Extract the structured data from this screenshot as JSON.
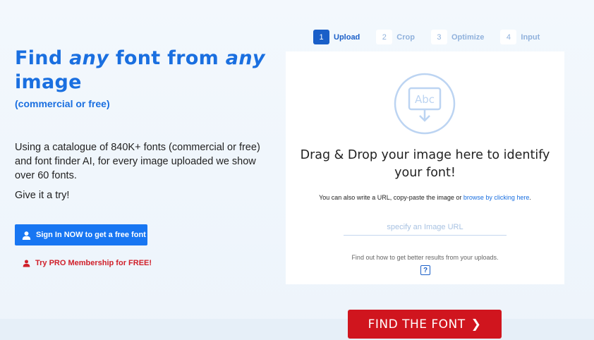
{
  "hero": {
    "title_part1": "Find",
    "title_any1": "any",
    "title_part2": "font from",
    "title_any2": "any",
    "title_part3": "image",
    "subtitle": "(commercial or free)",
    "description": "Using a catalogue of 840K+ fonts (commercial or free) and font finder AI, for every image uploaded we show over 60 fonts.",
    "try_text": "Give it a try!",
    "signin_label": "Sign In NOW to get a free font",
    "pro_label": "Try PRO Membership for FREE!"
  },
  "steps": [
    {
      "num": "1",
      "label": "Upload",
      "active": true
    },
    {
      "num": "2",
      "label": "Crop",
      "active": false
    },
    {
      "num": "3",
      "label": "Optimize",
      "active": false
    },
    {
      "num": "4",
      "label": "Input",
      "active": false
    }
  ],
  "upload": {
    "illustration_text": "Abc",
    "drag_line1": "Drag & Drop your image here to identify",
    "drag_line2": "your font!",
    "hint_prefix": "You can also write a URL, copy-paste the image or",
    "hint_link": "browse by clicking here",
    "hint_suffix": ".",
    "url_placeholder": "specify an Image URL",
    "url_value": "",
    "tip": "Find out how to get better results from your uploads.",
    "help_glyph": "?"
  },
  "find_button": {
    "label": "FIND THE FONT",
    "arrow": "❯"
  },
  "colors": {
    "primary_blue": "#1876f2",
    "headline_blue": "#1a6fe0",
    "step_active": "#1a5fc8",
    "red": "#d0151e"
  },
  "icons": {
    "signin": "user-icon",
    "pro": "user-icon",
    "upload": "image-upload-icon",
    "help": "help-icon",
    "arrow": "chevron-right-icon"
  }
}
